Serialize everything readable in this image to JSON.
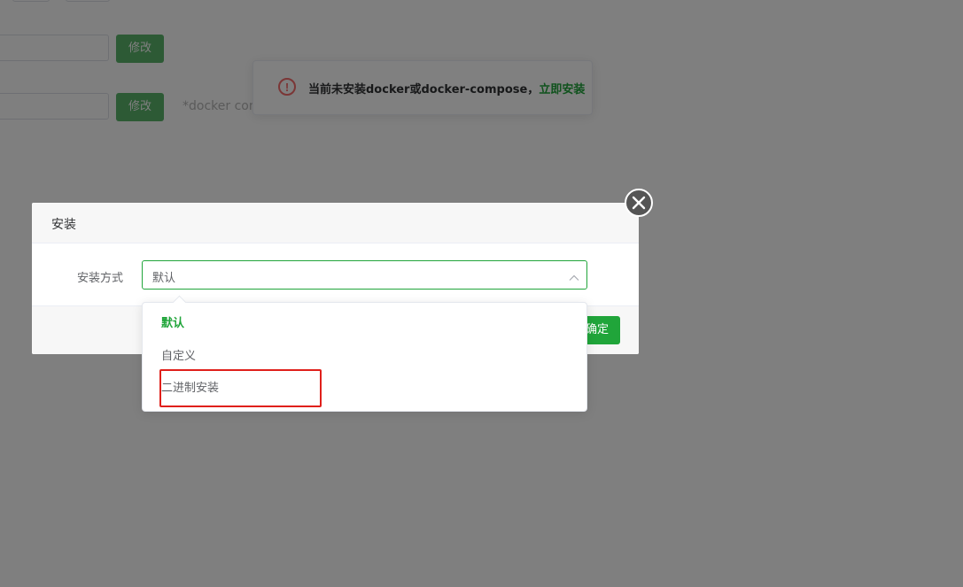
{
  "background": {
    "modify_button_1": "修改",
    "modify_button_2": "修改",
    "hint_text": "*docker com"
  },
  "toast": {
    "message": "当前未安装docker或docker-compose，",
    "link": "立即安装",
    "icon": "exclamation-circle-icon",
    "icon_color": "#f56c6c"
  },
  "dialog": {
    "title": "安装",
    "form": {
      "label": "安装方式",
      "selected_value": "默认"
    },
    "confirm_label": "确定",
    "close_icon": "close-icon"
  },
  "dropdown": {
    "options": [
      {
        "label": "默认",
        "selected": true
      },
      {
        "label": "自定义",
        "selected": false
      },
      {
        "label": "二进制安装",
        "selected": false
      }
    ]
  },
  "colors": {
    "accent": "#20a53a",
    "annotation": "#e0201b"
  }
}
